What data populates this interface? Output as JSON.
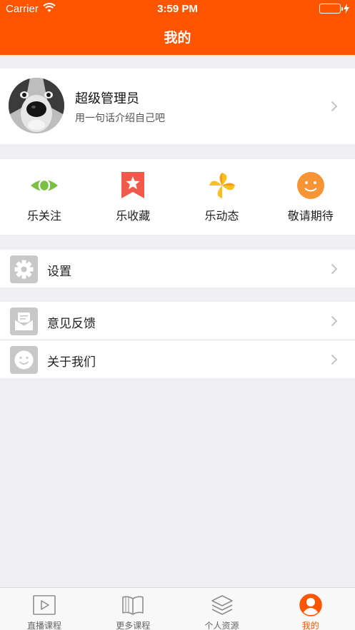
{
  "status_bar": {
    "carrier": "Carrier",
    "time": "3:59 PM",
    "battery_level": 1.0
  },
  "nav": {
    "title": "我的"
  },
  "profile": {
    "name": "超级管理员",
    "subtitle": "用一句话介绍自己吧"
  },
  "quick_actions": [
    {
      "label": "乐关注",
      "icon": "eye-icon",
      "color": "#7ac143"
    },
    {
      "label": "乐收藏",
      "icon": "bookmark-star-icon",
      "color": "#f15a4a"
    },
    {
      "label": "乐动态",
      "icon": "pinwheel-icon",
      "color": "#fbbf24"
    },
    {
      "label": "敬请期待",
      "icon": "smiley-icon",
      "color": "#f79433"
    }
  ],
  "menu": {
    "settings": {
      "label": "设置",
      "icon": "gear-icon"
    },
    "feedback": {
      "label": "意见反馈",
      "icon": "mail-icon"
    },
    "about": {
      "label": "关于我们",
      "icon": "smiley-icon"
    }
  },
  "tabs": [
    {
      "label": "直播课程",
      "icon": "play-icon",
      "active": false
    },
    {
      "label": "更多课程",
      "icon": "book-icon",
      "active": false
    },
    {
      "label": "个人资源",
      "icon": "layers-icon",
      "active": false
    },
    {
      "label": "我的",
      "icon": "user-icon",
      "active": true
    }
  ],
  "colors": {
    "brand": "#ff5500",
    "background": "#efeff4"
  }
}
